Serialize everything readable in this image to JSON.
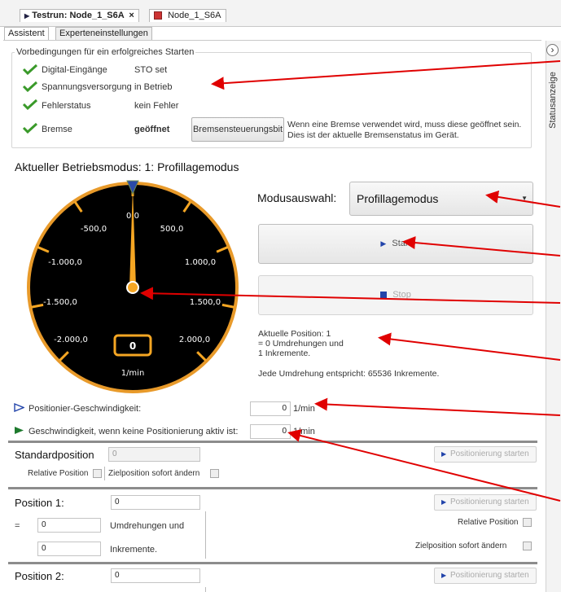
{
  "tabs": {
    "doc_tab_1": "Testrun: Node_1_S6A",
    "doc_tab_1_close": "×",
    "doc_tab_2": "Node_1_S6A"
  },
  "subtabs": {
    "assistant": "Assistent",
    "expert": "Experteneinstellungen"
  },
  "preconditions": {
    "title": "Vorbedingungen für ein erfolgreiches Starten",
    "rows": [
      {
        "label": "Digital-Eingänge",
        "value": "STO set"
      },
      {
        "label": "Spannungsversorgung",
        "value": "in Betrieb"
      },
      {
        "label": "Fehlerstatus",
        "value": "kein Fehler"
      },
      {
        "label": "Bremse",
        "value": "geöffnet"
      }
    ],
    "brake_button": "Bremsensteuerungsbit",
    "brake_note": "Wenn eine Bremse verwendet wird, muss diese geöffnet sein.",
    "brake_note2": "Dies ist der aktuelle Bremsenstatus im Gerät."
  },
  "sidebar": {
    "label": "Statusanzeige",
    "toggle": "›"
  },
  "mode": {
    "heading": "Aktueller Betriebsmodus: 1: Profillagemodus",
    "select_label": "Modusauswahl:",
    "select_value": "Profillagemodus",
    "start": "Start",
    "stop": "Stop"
  },
  "gauge": {
    "ticks": [
      "0,0",
      "500,0",
      "1.000,0",
      "1.500,0",
      "2.000,0",
      "-500,0",
      "-1.000,0",
      "-1.500,0",
      "-2.000,0"
    ],
    "value_display": "0",
    "unit": "1/min",
    "needle_value": 0,
    "accent_color": "#f5a623"
  },
  "position_info": {
    "line1": "Aktuelle Position: 1",
    "line2": "= 0 Umdrehungen und",
    "line3": "1 Inkremente.",
    "line4": "Jede Umdrehung entspricht: 65536 Inkremente."
  },
  "speeds": {
    "pos_speed_label": "Positionier-Geschwindigkeit:",
    "pos_speed_value": "0",
    "pos_speed_unit": "1/min",
    "idle_speed_label": "Geschwindigkeit, wenn keine Positionierung aktiv ist:",
    "idle_speed_value": "0",
    "idle_speed_unit": "1/min"
  },
  "standard_position": {
    "label": "Standardposition",
    "value": "0",
    "relative": "Relative Position",
    "immediate": "Zielposition sofort ändern",
    "start": "Positionierung starten"
  },
  "position1": {
    "label": "Position 1:",
    "value": "0",
    "eq": "=",
    "revs": "0",
    "revs_label": "Umdrehungen und",
    "incs": "0",
    "incs_label": "Inkremente.",
    "relative": "Relative Position",
    "immediate": "Zielposition sofort ändern",
    "start": "Positionierung starten"
  },
  "position2": {
    "label": "Position 2:",
    "value": "0",
    "start": "Positionierung starten"
  },
  "colors": {
    "annotation_arrow": "#e00000",
    "check_green": "#3a9a2a",
    "speed_blue": "#2244aa",
    "speed_green": "#1e7a2e"
  }
}
